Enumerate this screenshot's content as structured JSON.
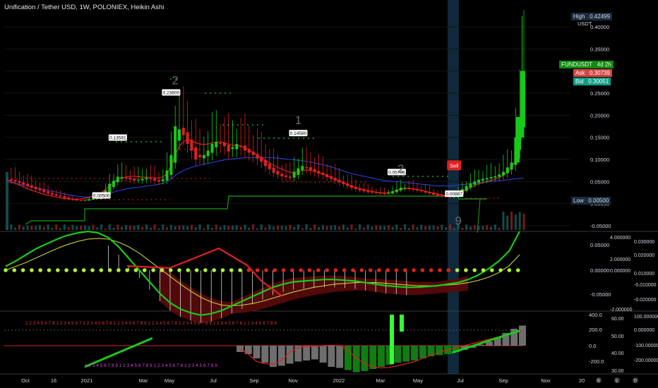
{
  "header": {
    "title": "Unification / Tether USD, 1W, POLONIEX, Heikin Ashi",
    "currency": "USDT"
  },
  "price_tags": {
    "high_label": "High",
    "high_value": "0.42499",
    "symbol": "FUNDUSDT",
    "countdown": "4d 2h",
    "ask_label": "Ask",
    "ask_value": "0.30739",
    "bid_label": "Bid",
    "bid_value": "0.30051",
    "low_label": "Low",
    "low_value": "0.00500"
  },
  "colors": {
    "up": "#19c919",
    "down": "#e02020",
    "sell_badge": "#e0201f",
    "high_tag": "#1c2b3c",
    "symbol_tag": "#128a12",
    "ask_tag": "#d64545",
    "bid_tag": "#119e86",
    "blue_line": "#2a3fd6",
    "support_line": "#16a016",
    "highlight_band": "#1b4a6b"
  },
  "chart_data": {
    "type": "line",
    "title": "Unification / Tether USD, 1W, POLONIEX, Heikin Ashi",
    "x_ticks": [
      "Oct",
      "16",
      "2021",
      "Mar",
      "May",
      "Jul",
      "Sep",
      "Nov",
      "2022",
      "Mar",
      "May",
      "Jul",
      "Sep",
      "Nov",
      "20"
    ],
    "main_pane": {
      "y_ticks": [
        "0.40000",
        "0.35000",
        "0.30000",
        "0.25000",
        "0.20000",
        "0.15000",
        "0.10000",
        "0.05000",
        "0.00000",
        "-0.05000"
      ],
      "y_range": [
        -0.05,
        0.42
      ],
      "price_labels": [
        {
          "text": "0.23800",
          "x_week": 40,
          "price": 0.238
        },
        {
          "text": "0.13591",
          "x_week": 27,
          "price": 0.136
        },
        {
          "text": "0.14580",
          "x_week": 71,
          "price": 0.146
        },
        {
          "text": "0.05795",
          "x_week": 95,
          "price": 0.058
        },
        {
          "text": "0.00500",
          "x_week": 23,
          "price": 0.005
        },
        {
          "text": "0.00887",
          "x_week": 109,
          "price": 0.009
        }
      ],
      "count_labels": [
        {
          "text": "2",
          "x_week": 41,
          "price": 0.27
        },
        {
          "text": "1",
          "x_week": 71,
          "price": 0.18
        },
        {
          "text": "2",
          "x_week": 96,
          "price": 0.07
        },
        {
          "text": "9",
          "x_week": 110,
          "price": -0.048
        }
      ],
      "sell_label": {
        "text": "Sell",
        "x_week": 109,
        "price": 0.058
      },
      "ha_close": [
        0.055,
        0.052,
        0.05,
        0.047,
        0.043,
        0.04,
        0.036,
        0.033,
        0.03,
        0.026,
        0.023,
        0.02,
        0.018,
        0.016,
        0.012,
        0.01,
        0.008,
        0.007,
        0.006,
        0.008,
        0.01,
        0.011,
        0.012,
        0.012,
        0.03,
        0.045,
        0.052,
        0.061,
        0.06,
        0.058,
        0.055,
        0.052,
        0.054,
        0.056,
        0.058,
        0.055,
        0.052,
        0.05,
        0.055,
        0.075,
        0.11,
        0.175,
        0.168,
        0.155,
        0.135,
        0.12,
        0.1,
        0.105,
        0.11,
        0.12,
        0.135,
        0.14,
        0.135,
        0.13,
        0.118,
        0.128,
        0.135,
        0.128,
        0.12,
        0.115,
        0.11,
        0.102,
        0.095,
        0.085,
        0.078,
        0.07,
        0.066,
        0.062,
        0.06,
        0.058,
        0.072,
        0.08,
        0.085,
        0.08,
        0.076,
        0.072,
        0.068,
        0.065,
        0.06,
        0.056,
        0.052,
        0.048,
        0.044,
        0.04,
        0.036,
        0.033,
        0.03,
        0.028,
        0.026,
        0.025,
        0.024,
        0.023,
        0.022,
        0.024,
        0.028,
        0.032,
        0.036,
        0.036,
        0.034,
        0.032,
        0.03,
        0.028,
        0.025,
        0.023,
        0.02,
        0.018,
        0.016,
        0.015,
        0.014,
        0.016,
        0.025,
        0.033,
        0.04,
        0.046,
        0.05,
        0.054,
        0.056,
        0.058,
        0.06,
        0.062,
        0.066,
        0.072,
        0.082,
        0.093,
        0.15,
        0.196,
        0.3
      ],
      "blue_ma": [
        0.05,
        0.048,
        0.046,
        0.044,
        0.042,
        0.04,
        0.038,
        0.036,
        0.034,
        0.032,
        0.03,
        0.028,
        0.026,
        0.024,
        0.022,
        0.02,
        0.018,
        0.017,
        0.016,
        0.015,
        0.015,
        0.016,
        0.018,
        0.02,
        0.022,
        0.024,
        0.026,
        0.029,
        0.031,
        0.033,
        0.035,
        0.036,
        0.037,
        0.038,
        0.04,
        0.041,
        0.042,
        0.044,
        0.046,
        0.05,
        0.056,
        0.064,
        0.07,
        0.075,
        0.079,
        0.082,
        0.085,
        0.087,
        0.089,
        0.091,
        0.093,
        0.095,
        0.097,
        0.099,
        0.1,
        0.101,
        0.102,
        0.103,
        0.104,
        0.104,
        0.104,
        0.104,
        0.104,
        0.104,
        0.104,
        0.104,
        0.103,
        0.102,
        0.101,
        0.1,
        0.099,
        0.098,
        0.097,
        0.096,
        0.094,
        0.092,
        0.09,
        0.088,
        0.086,
        0.083,
        0.08,
        0.077,
        0.074,
        0.071,
        0.068,
        0.066,
        0.064,
        0.062,
        0.06,
        0.058,
        0.056,
        0.054,
        0.052,
        0.051,
        0.05,
        0.05,
        0.049,
        0.048,
        0.047,
        0.046,
        0.045,
        0.044,
        0.043,
        0.042,
        0.041,
        0.04,
        0.04,
        0.04,
        0.04,
        0.041,
        0.042,
        0.043,
        0.044,
        0.045,
        0.046,
        0.047,
        0.048,
        0.049,
        0.05,
        0.051,
        0.052,
        0.053,
        0.054,
        0.055,
        0.056,
        0.057,
        0.058
      ],
      "red_ma": [
        0.054,
        0.05,
        0.046,
        0.042,
        0.038,
        0.034,
        0.03,
        0.027,
        0.024,
        0.021,
        0.019,
        0.017,
        0.015,
        0.013,
        0.012,
        0.011,
        0.01,
        0.01,
        0.011,
        0.012,
        0.014,
        0.017,
        0.02,
        0.025,
        0.032,
        0.04,
        0.048,
        0.055,
        0.058,
        0.06,
        0.062,
        0.062,
        0.061,
        0.06,
        0.06,
        0.059,
        0.058,
        0.058,
        0.06,
        0.068,
        0.085,
        0.11,
        0.13,
        0.14,
        0.145,
        0.142,
        0.138,
        0.135,
        0.134,
        0.135,
        0.137,
        0.139,
        0.14,
        0.138,
        0.134,
        0.132,
        0.132,
        0.13,
        0.126,
        0.121,
        0.116,
        0.11,
        0.104,
        0.098,
        0.092,
        0.087,
        0.082,
        0.078,
        0.074,
        0.071,
        0.071,
        0.073,
        0.075,
        0.076,
        0.075,
        0.073,
        0.07,
        0.067,
        0.063,
        0.059,
        0.055,
        0.051,
        0.047,
        0.043,
        0.04,
        0.037,
        0.034,
        0.032,
        0.03,
        0.028,
        0.026,
        0.025,
        0.024,
        0.025,
        0.027,
        0.03,
        0.033,
        0.034,
        0.034,
        0.033,
        0.032,
        0.03,
        0.028,
        0.026,
        0.024,
        0.022,
        0.02,
        0.018,
        0.017,
        0.018,
        0.022,
        0.027,
        0.032,
        0.037,
        0.041,
        0.045,
        0.048,
        0.051,
        0.053,
        0.056,
        0.059,
        0.064,
        0.071,
        0.081,
        0.1,
        0.13,
        0.18
      ]
    },
    "oscillator_pane": {
      "y_ticks_left": [
        "0.05000",
        "0.00000",
        "-0.05000"
      ],
      "y_ticks_mid": [
        "4.000000",
        "2.000000",
        "0.000000",
        "-2.000000"
      ],
      "y_ticks_right": [
        "0.030000",
        "0.020000",
        "0.010000",
        "-0.010000",
        "-0.020000"
      ],
      "macd": [
        0.005,
        0.012,
        0.02,
        0.028,
        0.034,
        0.04,
        0.045,
        0.048,
        0.05,
        0.048,
        0.042,
        0.03,
        0.015,
        0.0,
        -0.015,
        -0.03,
        -0.042,
        -0.05,
        -0.055,
        -0.058,
        -0.056,
        -0.052,
        -0.046,
        -0.04,
        -0.034,
        -0.028,
        -0.022,
        -0.018,
        -0.015,
        -0.014,
        -0.013,
        -0.012,
        -0.012,
        -0.013,
        -0.014,
        -0.016,
        -0.018,
        -0.02,
        -0.021,
        -0.022,
        -0.022,
        -0.021,
        -0.02,
        -0.018,
        -0.016,
        -0.012,
        -0.006,
        0.002,
        0.012,
        0.025,
        0.05
      ],
      "signal": [
        0.0,
        0.005,
        0.01,
        0.016,
        0.022,
        0.028,
        0.033,
        0.037,
        0.04,
        0.041,
        0.04,
        0.036,
        0.03,
        0.022,
        0.012,
        0.002,
        -0.008,
        -0.018,
        -0.027,
        -0.035,
        -0.041,
        -0.045,
        -0.046,
        -0.045,
        -0.043,
        -0.04,
        -0.036,
        -0.032,
        -0.028,
        -0.025,
        -0.022,
        -0.02,
        -0.018,
        -0.017,
        -0.016,
        -0.016,
        -0.016,
        -0.017,
        -0.018,
        -0.019,
        -0.02,
        -0.02,
        -0.02,
        -0.019,
        -0.018,
        -0.016,
        -0.013,
        -0.009,
        -0.003,
        0.006,
        0.02
      ]
    },
    "counter_pane": {
      "y_ticks_left": [
        "400.0",
        "200.0",
        "0.0",
        "-200.0"
      ],
      "y_ticks_mid": [
        "60.00",
        "50.00",
        "40.00",
        "30.00"
      ],
      "y_ticks_right": [
        "100.000000",
        "0.000000",
        "-100.000000",
        "-200.000000"
      ],
      "top_sequence": "1 2 3 4 5 6 7 8 1 2 3 4 5 6 7 1 2 3 4 5 6 7 8 1 2 3 4 5 6 7 8 9 1 2 3 4 5 6 7 8 1 2 3 4 5 6 7 8 9 1 2 3 4 5 6 7 8 1 2 3 4 5 6 7 8 9",
      "bottom_sequence": "1 2 3 4 5 6 7 8 9 1 2 3 4 5 6 7 8 9 1 2 3 4 5 6 7 8 1 2 3 4 5 6 7 8 9",
      "histogram": [
        -60,
        -80,
        -120,
        -160,
        -200,
        -190,
        -170,
        -150,
        -140,
        -130,
        -160,
        -200,
        -210,
        -230,
        -250,
        -240,
        -220,
        -200,
        -180,
        -160,
        -150,
        -140,
        -120,
        -100,
        -90,
        -80,
        -60,
        -40,
        -20,
        10,
        40,
        80,
        120,
        160,
        190
      ],
      "stoch_line": [
        -30,
        -80,
        -150,
        -170,
        -175,
        -140,
        -60,
        -20,
        -10,
        -5,
        0,
        5,
        0,
        -40,
        -120,
        -170,
        -200,
        -210,
        -205,
        -190,
        -170,
        -150,
        -120,
        -90,
        -60,
        -40,
        -20,
        0,
        20,
        40,
        60,
        80,
        100,
        120,
        140
      ]
    }
  }
}
